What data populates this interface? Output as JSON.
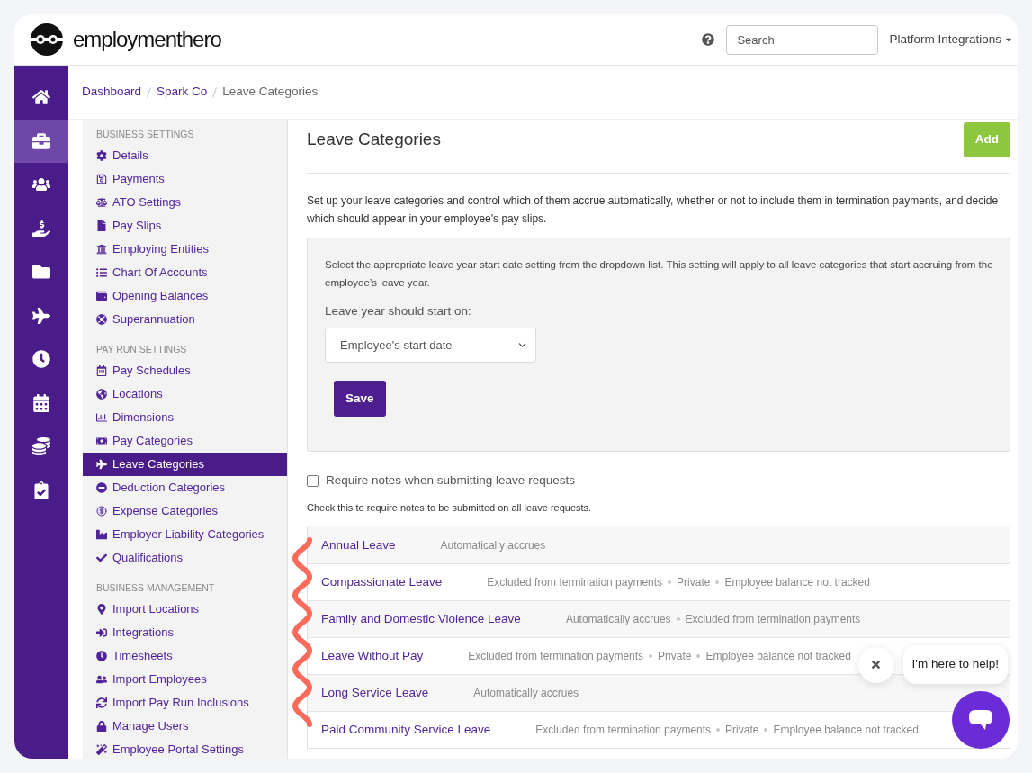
{
  "header": {
    "logo_text": "employmenthero",
    "search": {
      "placeholder": "Search"
    },
    "account_menu": "Platform Integrations"
  },
  "nav_rail": [
    {
      "selected": false
    },
    {
      "selected": true
    },
    {
      "selected": false
    },
    {
      "selected": false
    },
    {
      "selected": false
    },
    {
      "selected": false
    },
    {
      "selected": false
    },
    {
      "selected": false
    },
    {
      "selected": false
    },
    {
      "selected": false
    }
  ],
  "breadcrumb": [
    {
      "label": "Dashboard",
      "current": false
    },
    {
      "label": "Spark Co",
      "current": false
    },
    {
      "label": "Leave Categories",
      "current": true
    }
  ],
  "settings_sidebar": [
    {
      "heading": "BUSINESS SETTINGS",
      "items": [
        {
          "label": "Details",
          "selected": false
        },
        {
          "label": "Payments",
          "selected": false
        },
        {
          "label": "ATO Settings",
          "selected": false
        },
        {
          "label": "Pay Slips",
          "selected": false
        },
        {
          "label": "Employing Entities",
          "selected": false
        },
        {
          "label": "Chart Of Accounts",
          "selected": false
        },
        {
          "label": "Opening Balances",
          "selected": false
        },
        {
          "label": "Superannuation",
          "selected": false
        }
      ]
    },
    {
      "heading": "PAY RUN SETTINGS",
      "items": [
        {
          "label": "Pay Schedules",
          "selected": false
        },
        {
          "label": "Locations",
          "selected": false
        },
        {
          "label": "Dimensions",
          "selected": false
        },
        {
          "label": "Pay Categories",
          "selected": false
        },
        {
          "label": "Leave Categories",
          "selected": true
        },
        {
          "label": "Deduction Categories",
          "selected": false
        },
        {
          "label": "Expense Categories",
          "selected": false
        },
        {
          "label": "Employer Liability Categories",
          "selected": false
        },
        {
          "label": "Qualifications",
          "selected": false
        }
      ]
    },
    {
      "heading": "BUSINESS MANAGEMENT",
      "items": [
        {
          "label": "Import Locations",
          "selected": false
        },
        {
          "label": "Integrations",
          "selected": false
        },
        {
          "label": "Timesheets",
          "selected": false
        },
        {
          "label": "Import Employees",
          "selected": false
        },
        {
          "label": "Import Pay Run Inclusions",
          "selected": false
        },
        {
          "label": "Manage Users",
          "selected": false
        },
        {
          "label": "Employee Portal Settings",
          "selected": false
        }
      ]
    }
  ],
  "main": {
    "title": "Leave Categories",
    "add_button": "Add",
    "description": "Set up your leave categories and control which of them accrue automatically, whether or not to include them in termination payments, and decide which should appear in your employee's pay slips.",
    "leave_year_panel": {
      "note": "Select the appropriate leave year start date setting from the dropdown list. This setting will apply to all leave categories that start accruing from the employee’s leave year.",
      "field_label": "Leave year should start on:",
      "select_value": "Employee's start date",
      "save_button": "Save"
    },
    "require_notes": {
      "label": "Require notes when submitting leave requests",
      "checked": false,
      "hint": "Check this to require notes to be submitted on all leave requests."
    },
    "categories": [
      {
        "name": "Annual Leave",
        "tags": [
          "Automatically accrues"
        ]
      },
      {
        "name": "Compassionate Leave",
        "tags": [
          "Excluded from termination payments",
          "Private",
          "Employee balance not tracked"
        ]
      },
      {
        "name": "Family and Domestic Violence Leave",
        "tags": [
          "Automatically accrues",
          "Excluded from termination payments"
        ]
      },
      {
        "name": "Leave Without Pay",
        "tags": [
          "Excluded from termination payments",
          "Private",
          "Employee balance not tracked"
        ]
      },
      {
        "name": "Long Service Leave",
        "tags": [
          "Automatically accrues"
        ]
      },
      {
        "name": "Paid Community Service Leave",
        "tags": [
          "Excluded from termination payments",
          "Private",
          "Employee balance not tracked"
        ]
      }
    ]
  },
  "chat_widget": {
    "message": "I'm here to help!"
  }
}
